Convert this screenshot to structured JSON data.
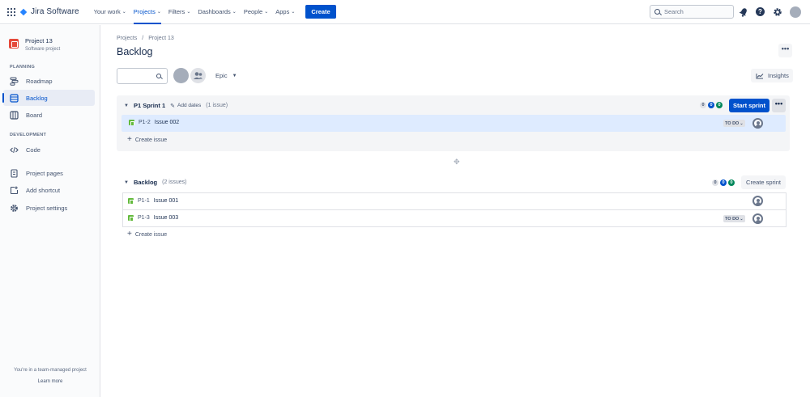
{
  "topnav": {
    "logo_text": "Jira Software",
    "menu": [
      {
        "label": "Your work",
        "active": false
      },
      {
        "label": "Projects",
        "active": true
      },
      {
        "label": "Filters",
        "active": false
      },
      {
        "label": "Dashboards",
        "active": false
      },
      {
        "label": "People",
        "active": false
      },
      {
        "label": "Apps",
        "active": false
      }
    ],
    "create_label": "Create",
    "search_placeholder": "Search",
    "help_glyph": "?"
  },
  "sidebar": {
    "project_name": "Project 13",
    "project_type": "Software project",
    "planning_heading": "PLANNING",
    "development_heading": "DEVELOPMENT",
    "items": [
      {
        "label": "Roadmap",
        "icon": "roadmap-icon"
      },
      {
        "label": "Backlog",
        "icon": "backlog-icon",
        "active": true
      },
      {
        "label": "Board",
        "icon": "board-icon"
      },
      {
        "label": "Code",
        "icon": "code-icon"
      },
      {
        "label": "Project pages",
        "icon": "pages-icon"
      },
      {
        "label": "Add shortcut",
        "icon": "add-shortcut-icon"
      },
      {
        "label": "Project settings",
        "icon": "settings-icon"
      }
    ],
    "footer_text": "You're in a team-managed project",
    "learn_more": "Learn more"
  },
  "main": {
    "breadcrumbs": [
      "Projects",
      "Project 13"
    ],
    "breadcrumb_sep": "/",
    "title": "Backlog",
    "more_glyph": "•••",
    "epic_label": "Epic",
    "insights_label": "Insights",
    "sprint": {
      "name": "P1 Sprint 1",
      "add_dates": "Add dates",
      "issue_count": "(1 issue)",
      "counts": [
        "0",
        "0",
        "0"
      ],
      "start_label": "Start sprint",
      "issues": [
        {
          "key": "P1-2",
          "summary": "Issue 002",
          "status": "TO DO"
        }
      ],
      "create_issue": "Create issue"
    },
    "backlog": {
      "name": "Backlog",
      "issue_count": "(2 issues)",
      "counts": [
        "0",
        "0",
        "0"
      ],
      "create_sprint_label": "Create sprint",
      "issues": [
        {
          "key": "P1-1",
          "summary": "Issue 001",
          "status": ""
        },
        {
          "key": "P1-3",
          "summary": "Issue 003",
          "status": "TO DO"
        }
      ],
      "create_issue": "Create issue"
    }
  },
  "colors": {
    "brand_blue": "#0052cc",
    "story_green": "#63ba3c",
    "project_avatar": "#e5493a"
  }
}
